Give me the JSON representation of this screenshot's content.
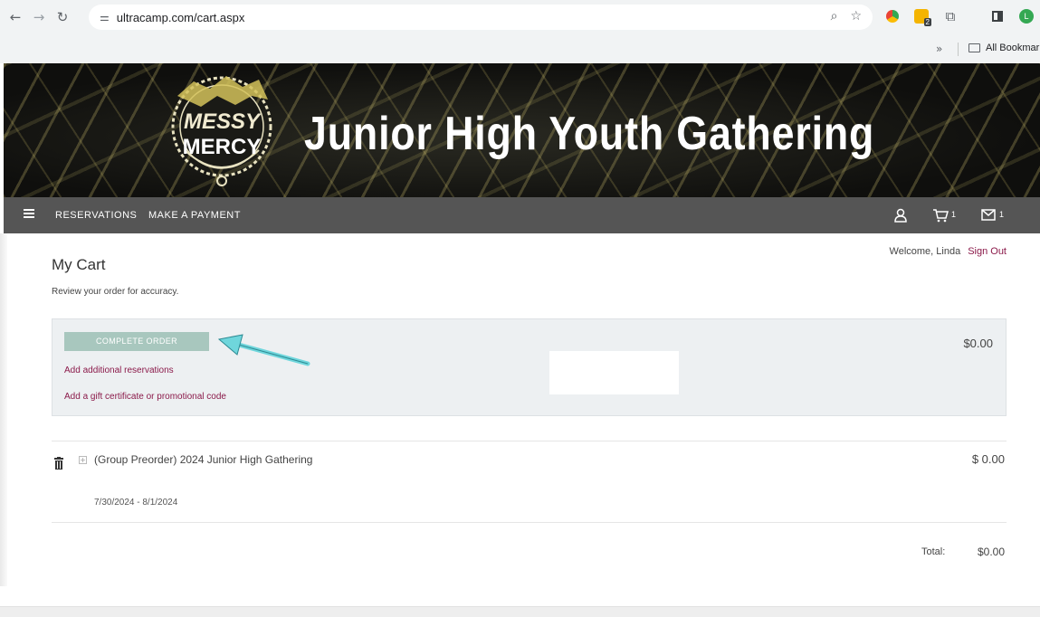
{
  "browser": {
    "url": "ultracamp.com/cart.aspx",
    "bookmarks_chevron": "»",
    "bookmarks_label": "All Bookmarks",
    "extension_badge": "2",
    "profile_initial": "L"
  },
  "banner": {
    "logo_line1": "MESSY",
    "logo_line2": "MERCY",
    "title": "Junior High Youth Gathering"
  },
  "nav": {
    "reservations": "RESERVATIONS",
    "make_payment": "MAKE A PAYMENT",
    "cart_count": "1",
    "messages_count": "1"
  },
  "account": {
    "welcome": "Welcome, Linda",
    "sign_out": "Sign Out"
  },
  "cart": {
    "title": "My Cart",
    "subtitle": "Review your order for accuracy.",
    "complete_order": "COMPLETE ORDER",
    "add_reservations": "Add additional reservations",
    "add_gift": "Add a gift certificate or promotional code",
    "order_total": "$0.00",
    "items": [
      {
        "name": "(Group Preorder) 2024 Junior High Gathering",
        "price": "$ 0.00",
        "dates": "7/30/2024 - 8/1/2024"
      }
    ],
    "total_label": "Total:",
    "total_value": "$0.00"
  },
  "colors": {
    "accent_link": "#8b1a4a",
    "button": "#a8c7be",
    "nav_bar": "#555555",
    "arrow": "#6fd6dc"
  }
}
